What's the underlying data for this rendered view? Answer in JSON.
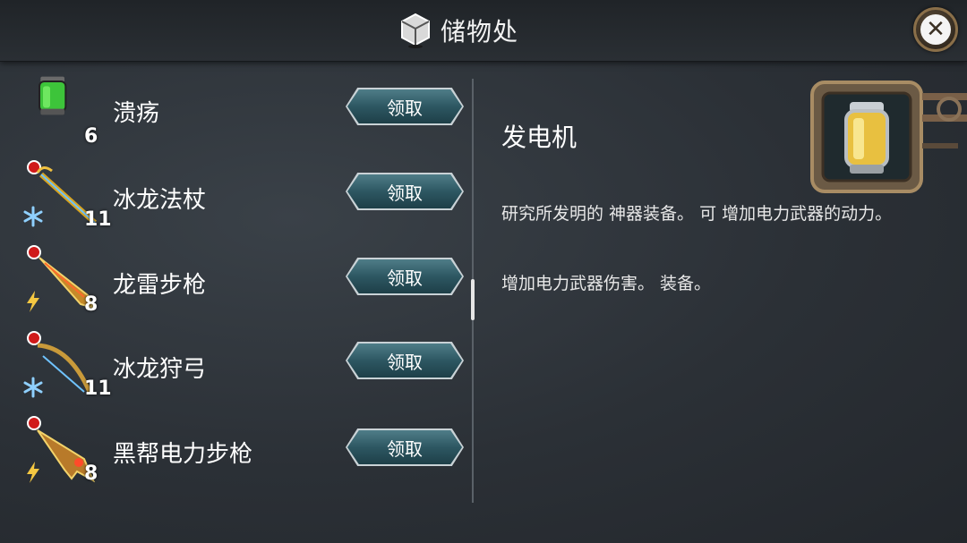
{
  "header": {
    "title": "储物处"
  },
  "items": [
    {
      "name": "溃疡",
      "count": "6",
      "button": "领取",
      "element": ""
    },
    {
      "name": "冰龙法杖",
      "count": "11",
      "button": "领取",
      "element": "ice"
    },
    {
      "name": "龙雷步枪",
      "count": "8",
      "button": "领取",
      "element": "lightning"
    },
    {
      "name": "冰龙狩弓",
      "count": "11",
      "button": "领取",
      "element": "ice"
    },
    {
      "name": "黑帮电力步枪",
      "count": "8",
      "button": "领取",
      "element": "lightning"
    }
  ],
  "detail": {
    "title": "发电机",
    "description1": "研究所发明的 神器装备。 可 增加电力武器的动力。",
    "description2": "增加电力武器伤害。 装备。"
  },
  "icons": {
    "storage": "box-icon",
    "close": "close-icon",
    "ice": "snowflake-icon",
    "lightning": "lightning-icon"
  },
  "colors": {
    "button": "#2d5762",
    "background": "#2b3036",
    "ice": "#8fd0ff",
    "lightning": "#f5c842"
  }
}
